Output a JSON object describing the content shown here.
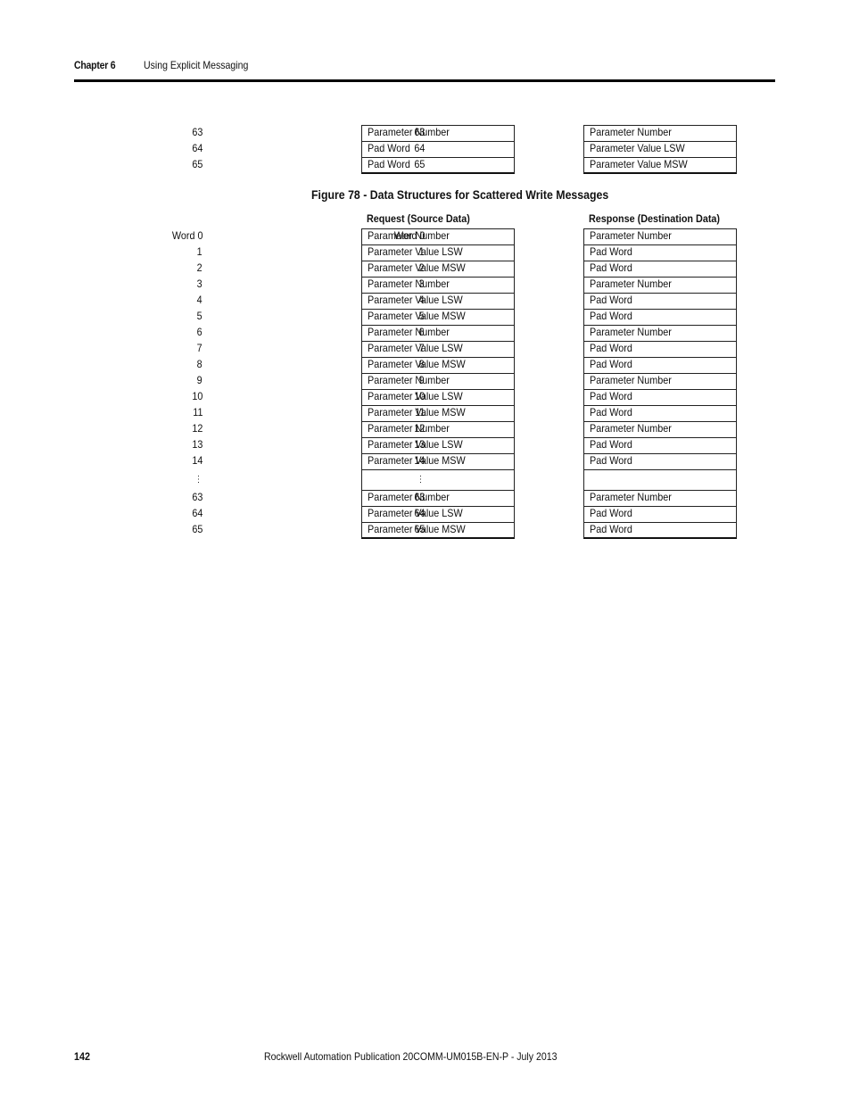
{
  "header": {
    "chapter": "Chapter 6",
    "title": "Using Explicit Messaging"
  },
  "top_tables": {
    "left": [
      {
        "word": "63",
        "value": "Parameter Number"
      },
      {
        "word": "64",
        "value": "Pad Word"
      },
      {
        "word": "65",
        "value": "Pad Word"
      }
    ],
    "right": [
      {
        "word": "63",
        "value": "Parameter Number"
      },
      {
        "word": "64",
        "value": "Parameter Value LSW"
      },
      {
        "word": "65",
        "value": "Parameter Value MSW"
      }
    ]
  },
  "figure": {
    "caption": "Figure 78 - Data Structures for Scattered Write Messages",
    "request": {
      "heading": "Request (Source Data)",
      "rows": [
        {
          "word": "Word 0",
          "value": "Parameter Number"
        },
        {
          "word": "1",
          "value": "Parameter Value LSW"
        },
        {
          "word": "2",
          "value": "Parameter Value MSW"
        },
        {
          "word": "3",
          "value": "Parameter Number"
        },
        {
          "word": "4",
          "value": "Parameter Value LSW"
        },
        {
          "word": "5",
          "value": "Parameter Value MSW"
        },
        {
          "word": "6",
          "value": "Parameter Number"
        },
        {
          "word": "7",
          "value": "Parameter Value LSW"
        },
        {
          "word": "8",
          "value": "Parameter Value MSW"
        },
        {
          "word": "9",
          "value": "Parameter Number"
        },
        {
          "word": "10",
          "value": "Parameter Value LSW"
        },
        {
          "word": "11",
          "value": "Parameter Value MSW"
        },
        {
          "word": "12",
          "value": "Parameter Number"
        },
        {
          "word": "13",
          "value": "Parameter Value LSW"
        },
        {
          "word": "14",
          "value": "Parameter Value MSW"
        },
        {
          "word": "⋮",
          "value": ""
        },
        {
          "word": "63",
          "value": "Parameter Number"
        },
        {
          "word": "64",
          "value": "Parameter Value LSW"
        },
        {
          "word": "65",
          "value": "Parameter Value MSW"
        }
      ]
    },
    "response": {
      "heading": "Response (Destination Data)",
      "rows": [
        {
          "word": "Word 0",
          "value": "Parameter Number"
        },
        {
          "word": "1",
          "value": "Pad Word"
        },
        {
          "word": "2",
          "value": "Pad Word"
        },
        {
          "word": "3",
          "value": "Parameter Number"
        },
        {
          "word": "4",
          "value": "Pad Word"
        },
        {
          "word": "5",
          "value": "Pad Word"
        },
        {
          "word": "6",
          "value": "Parameter Number"
        },
        {
          "word": "7",
          "value": "Pad Word"
        },
        {
          "word": "8",
          "value": "Pad Word"
        },
        {
          "word": "9",
          "value": "Parameter Number"
        },
        {
          "word": "10",
          "value": "Pad Word"
        },
        {
          "word": "11",
          "value": "Pad Word"
        },
        {
          "word": "12",
          "value": "Parameter Number"
        },
        {
          "word": "13",
          "value": "Pad Word"
        },
        {
          "word": "14",
          "value": "Pad Word"
        },
        {
          "word": "⋮",
          "value": ""
        },
        {
          "word": "63",
          "value": "Parameter Number"
        },
        {
          "word": "64",
          "value": "Pad Word"
        },
        {
          "word": "65",
          "value": "Pad Word"
        }
      ]
    }
  },
  "footer": {
    "page_number": "142",
    "publication": "Rockwell Automation Publication  20COMM-UM015B-EN-P - July 2013"
  }
}
